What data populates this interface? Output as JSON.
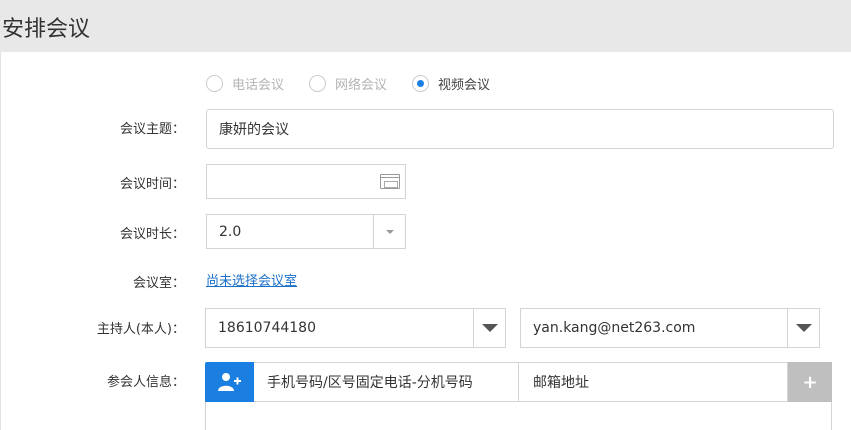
{
  "page": {
    "title": "安排会议"
  },
  "meeting_type": {
    "options": [
      "电话会议",
      "网络会议",
      "视频会议"
    ],
    "selected": "视频会议"
  },
  "form": {
    "subject_label": "会议主题：",
    "subject_value": "康妍的会议",
    "time_label": "会议时间：",
    "time_value": "",
    "duration_label": "会议时长：",
    "duration_value": "2.0",
    "room_label": "会议室：",
    "room_link": "尚未选择会议室",
    "host_label": "主持人(本人)：",
    "host_phone": "18610744180",
    "host_email": "yan.kang@net263.com",
    "participants_label": "参会人信息：",
    "participant_phone_placeholder": "手机号码/区号固定电话-分机号码",
    "participant_email_placeholder": "邮箱地址",
    "add_symbol": "+"
  },
  "icons": {
    "add_person": "add-person-icon",
    "calendar": "calendar-icon",
    "dropdown": "chevron-down-icon"
  },
  "colors": {
    "accent": "#1a7fe0",
    "link": "#1a6fc9",
    "header_bg": "#e8e8e8",
    "add_button_bg": "#bfbfbf"
  }
}
